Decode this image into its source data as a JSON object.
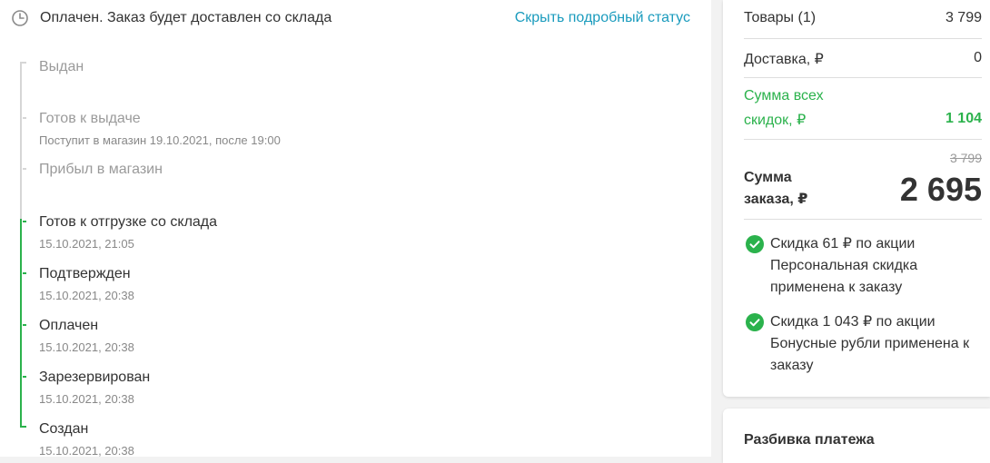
{
  "status": {
    "icon": "clock-icon",
    "text": "Оплачен. Заказ будет доставлен со склада",
    "hide_link": "Скрыть подробный статус"
  },
  "timeline": [
    {
      "title": "Выдан",
      "subtitle": "",
      "state": "inactive"
    },
    {
      "title": "Готов к выдаче",
      "subtitle": "Поступит в магазин 19.10.2021, после 19:00",
      "state": "inactive"
    },
    {
      "title": "Прибыл в магазин",
      "subtitle": "",
      "state": "inactive"
    },
    {
      "title": "Готов к отгрузке со склада",
      "subtitle": "15.10.2021, 21:05",
      "state": "done"
    },
    {
      "title": "Подтвержден",
      "subtitle": "15.10.2021, 20:38",
      "state": "done"
    },
    {
      "title": "Оплачен",
      "subtitle": "15.10.2021, 20:38",
      "state": "done"
    },
    {
      "title": "Зарезервирован",
      "subtitle": "15.10.2021, 20:38",
      "state": "done"
    },
    {
      "title": "Создан",
      "subtitle": "15.10.2021, 20:38",
      "state": "done"
    }
  ],
  "summary": {
    "goods_label": "Товары (1)",
    "goods_value": "3 799",
    "delivery_label": "Доставка, ₽",
    "delivery_value": "0",
    "discounts_label_1": "Сумма всех",
    "discounts_label_2": "скидок, ₽",
    "discounts_value": "1 104",
    "old_total": "3 799",
    "total_label_1": "Сумма",
    "total_label_2": "заказа, ₽",
    "total_value": "2 695"
  },
  "discounts": [
    {
      "icon": "check-circle-icon",
      "text": "Скидка 61 ₽ по акции Персональная скидка применена к заказу"
    },
    {
      "icon": "check-circle-icon",
      "text": "Скидка 1 043 ₽ по акции Бонусные рубли применена к заказу"
    }
  ],
  "payment": {
    "title": "Разбивка платежа"
  },
  "colors": {
    "accent_link": "#1a9bbd",
    "success_green": "#2bb24c",
    "muted_gray": "#9a9a9a"
  }
}
